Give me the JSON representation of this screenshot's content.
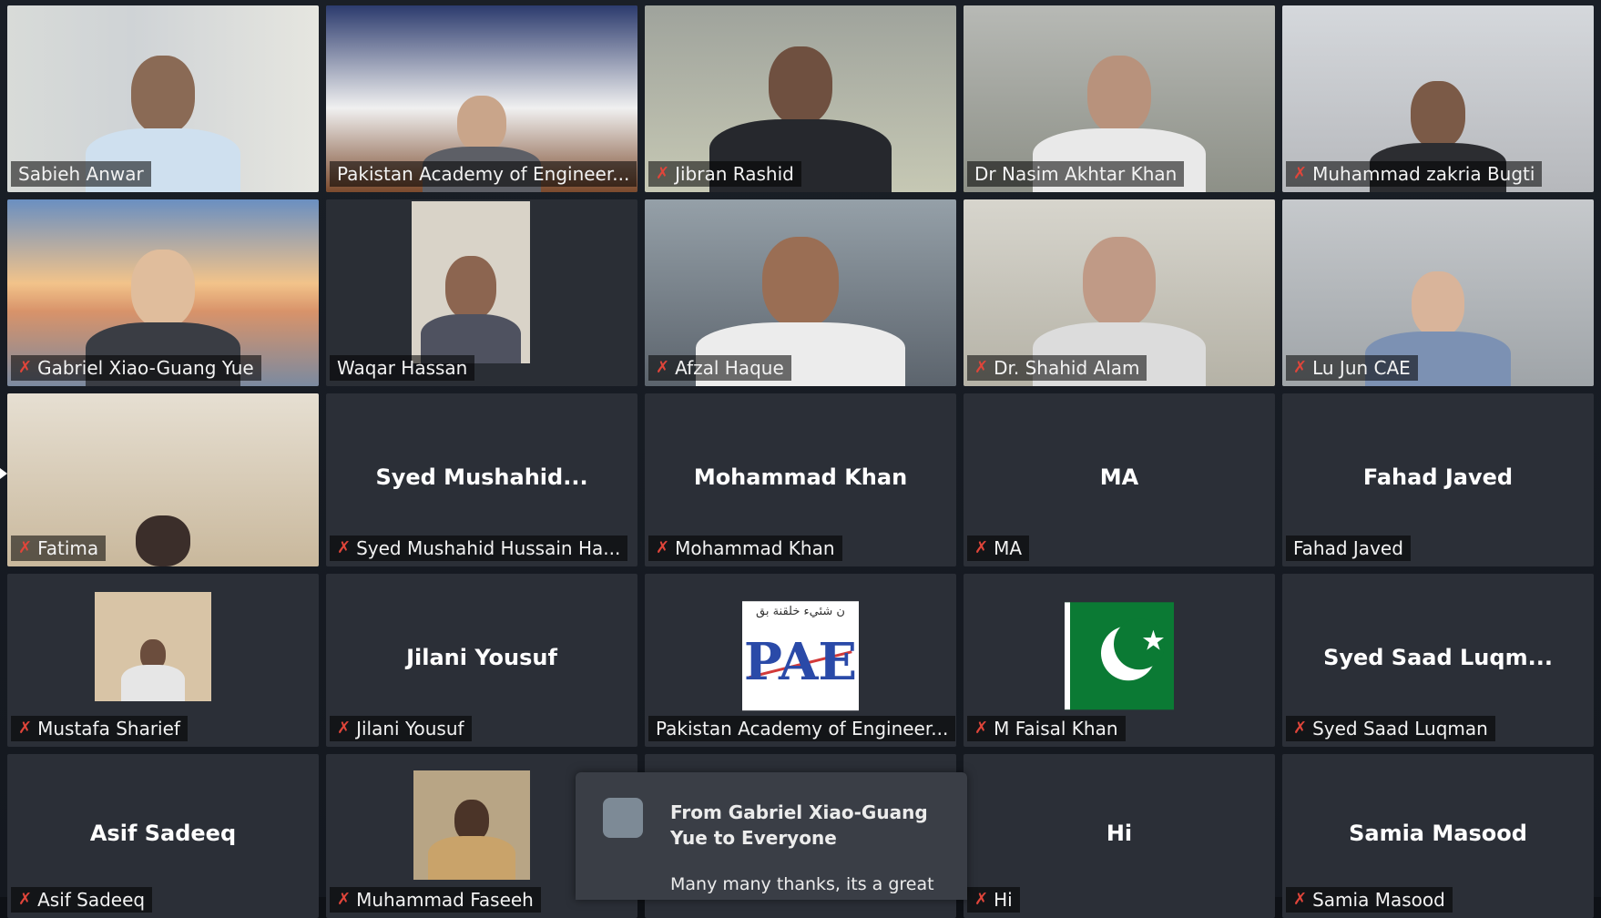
{
  "tiles": [
    {
      "name": "Sabieh Anwar",
      "muted": false,
      "center": ""
    },
    {
      "name": "Pakistan Academy of Engineer...",
      "muted": false,
      "center": ""
    },
    {
      "name": "Jibran Rashid",
      "muted": true,
      "center": ""
    },
    {
      "name": "Dr Nasim Akhtar Khan",
      "muted": false,
      "center": "",
      "active": true
    },
    {
      "name": "Muhammad zakria Bugti",
      "muted": true,
      "center": ""
    },
    {
      "name": "Gabriel Xiao-Guang Yue",
      "muted": true,
      "center": ""
    },
    {
      "name": "Waqar Hassan",
      "muted": false,
      "center": ""
    },
    {
      "name": "Afzal Haque",
      "muted": true,
      "center": ""
    },
    {
      "name": "Dr. Shahid Alam",
      "muted": true,
      "center": ""
    },
    {
      "name": "Lu Jun CAE",
      "muted": true,
      "center": ""
    },
    {
      "name": "Fatima",
      "muted": true,
      "center": ""
    },
    {
      "name": "Syed Mushahid Hussain Ha...",
      "muted": true,
      "center": "Syed  Mushahid..."
    },
    {
      "name": "Mohammad Khan",
      "muted": true,
      "center": "Mohammad Khan"
    },
    {
      "name": "MA",
      "muted": true,
      "center": "MA"
    },
    {
      "name": "Fahad Javed",
      "muted": false,
      "center": "Fahad Javed"
    },
    {
      "name": "Mustafa Sharief",
      "muted": true,
      "center": ""
    },
    {
      "name": "Jilani Yousuf",
      "muted": true,
      "center": "Jilani Yousuf"
    },
    {
      "name": "Pakistan Academy of Engineer...",
      "muted": false,
      "center": ""
    },
    {
      "name": "M Faisal Khan",
      "muted": true,
      "center": ""
    },
    {
      "name": "Syed Saad Luqman",
      "muted": true,
      "center": "Syed  Saad  Luqm..."
    },
    {
      "name": "Asif Sadeeq",
      "muted": true,
      "center": "Asif Sadeeq"
    },
    {
      "name": "Muhammad Faseeh",
      "muted": true,
      "center": ""
    },
    {
      "name": "",
      "muted": false,
      "center": ""
    },
    {
      "name": "Hi",
      "muted": true,
      "center": "Hi"
    },
    {
      "name": "Samia Masood",
      "muted": true,
      "center": "Samia Masood"
    }
  ],
  "logo": {
    "pai_text": "PAE",
    "arabic": "ن شئيء خلقنة بق"
  },
  "chat": {
    "from_line1": "From Gabriel Xiao-Guang",
    "from_line2": "Yue to Everyone",
    "message": "Many many thanks, its a great"
  },
  "icons": {
    "muted_mic": "muted-mic-icon"
  },
  "colors": {
    "active_speaker": "#d9d84a",
    "muted": "#e0453a",
    "tile_bg": "#2b2f37"
  }
}
